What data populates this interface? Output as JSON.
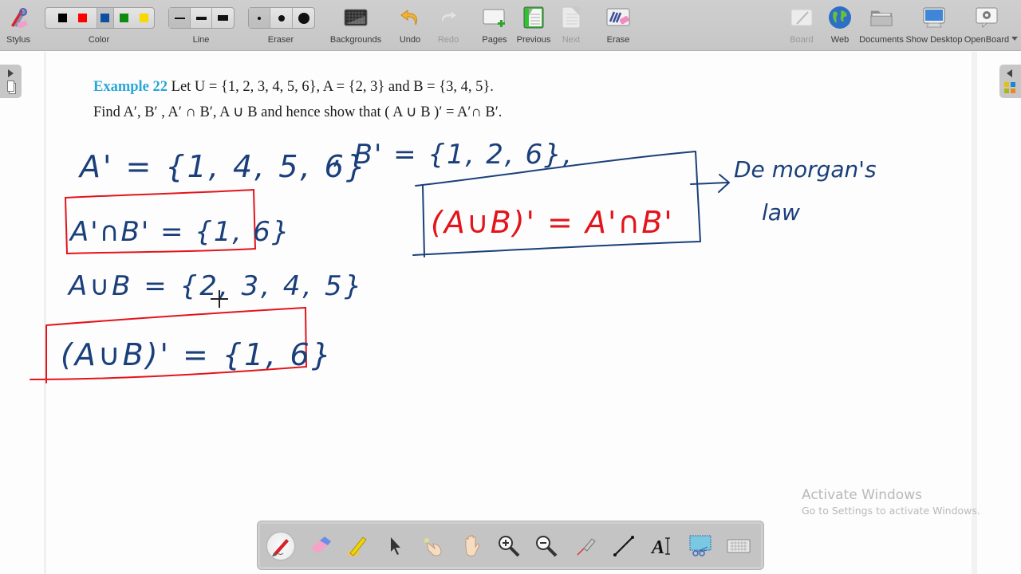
{
  "toolbar": {
    "stylus": {
      "label": "Stylus",
      "icon": "stylus-icon"
    },
    "color": {
      "label": "Color",
      "swatches": [
        "#000000",
        "#ff0000",
        "#0d4fa0",
        "#118a11",
        "#f7d800"
      ],
      "selected_index": 2
    },
    "line": {
      "label": "Line",
      "options": [
        "thin",
        "medium",
        "thick"
      ],
      "selected_index": 0
    },
    "eraser": {
      "label": "Eraser",
      "options": [
        "small",
        "medium",
        "large"
      ],
      "selected_index": 0
    },
    "backgrounds": {
      "label": "Backgrounds",
      "icon": "backgrounds-icon"
    },
    "undo": {
      "label": "Undo",
      "icon": "undo-icon",
      "enabled": true
    },
    "redo": {
      "label": "Redo",
      "icon": "redo-icon",
      "enabled": false
    },
    "pages": {
      "label": "Pages",
      "icon": "add-page-icon"
    },
    "previous": {
      "label": "Previous",
      "icon": "previous-page-icon",
      "enabled": true
    },
    "next": {
      "label": "Next",
      "icon": "next-page-icon",
      "enabled": false
    },
    "erase": {
      "label": "Erase",
      "icon": "erase-all-icon"
    },
    "board": {
      "label": "Board",
      "icon": "board-icon",
      "enabled": false
    },
    "web": {
      "label": "Web",
      "icon": "globe-icon"
    },
    "documents": {
      "label": "Documents",
      "icon": "folder-icon"
    },
    "show_desktop": {
      "label": "Show Desktop",
      "icon": "monitor-icon"
    },
    "openboard": {
      "label": "OpenBoard",
      "icon": "gear-icon"
    }
  },
  "problem": {
    "example_label": "Example 22",
    "line1": " Let U = {1, 2, 3, 4, 5, 6}, A = {2, 3} and B = {3, 4, 5}.",
    "line2": "Find A′, B′ ,  A′ ∩ B′, A ∪ B and hence show that (  A ∪ B  )′ = A′∩ B′."
  },
  "handwriting": {
    "a_complement": "A' = {1, 4, 5, 6}",
    "b_complement": ", B' = {1, 2, 6},",
    "a_int_b": "A'∩B' = {1, 6}",
    "a_union_b": "A∪B = {2, 3, 4, 5}",
    "a_union_b_complement": "(A∪B)' = {1, 6}",
    "law_box": "(A∪B)' =  A'∩B'",
    "law_name_line1": "De morgan's",
    "law_name_line2": "law",
    "ink_blue": "#1a3f7a",
    "ink_red": "#e3141b"
  },
  "watermark": {
    "title": "Activate Windows",
    "subtitle": "Go to Settings to activate Windows."
  },
  "bottom_tools": [
    {
      "name": "pen-tool",
      "active": true
    },
    {
      "name": "eraser-tool"
    },
    {
      "name": "highlighter-tool"
    },
    {
      "name": "select-tool"
    },
    {
      "name": "interact-tool"
    },
    {
      "name": "hand-tool"
    },
    {
      "name": "zoom-in-tool"
    },
    {
      "name": "zoom-out-tool"
    },
    {
      "name": "laser-pointer-tool"
    },
    {
      "name": "line-tool"
    },
    {
      "name": "text-tool"
    },
    {
      "name": "capture-tool"
    },
    {
      "name": "virtual-keyboard-tool"
    }
  ]
}
